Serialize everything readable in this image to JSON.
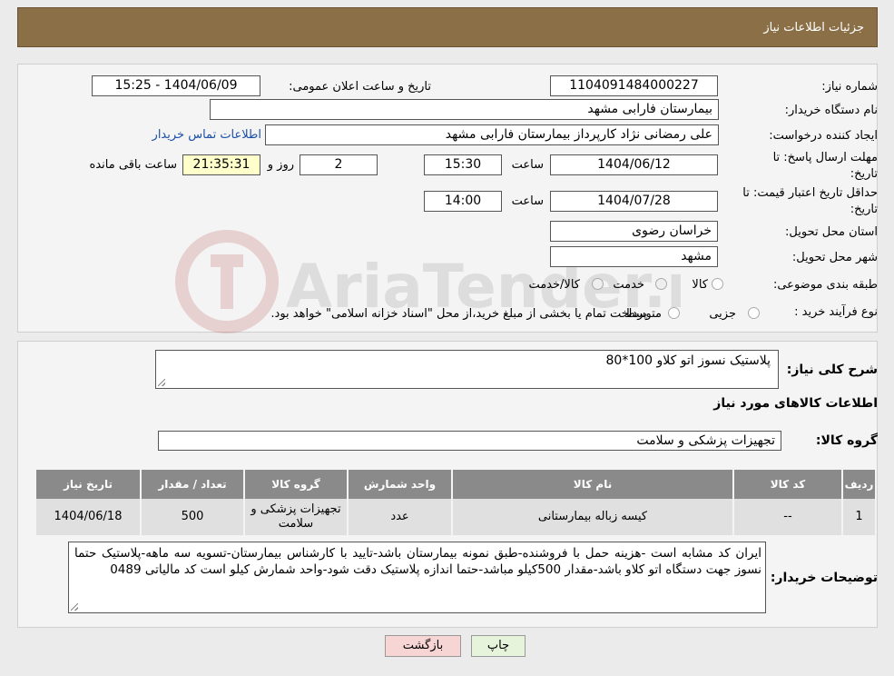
{
  "header": {
    "title": "جزئیات اطلاعات نیاز"
  },
  "watermark": {
    "text": "AriaTender.neT"
  },
  "form": {
    "need_number_label": "شماره نیاز:",
    "need_number": "1104091484000227",
    "announce_label": "تاریخ و ساعت اعلان عمومی:",
    "announce_value": "1404/06/09 - 15:25",
    "buyer_org_label": "نام دستگاه خریدار:",
    "buyer_org": "بیمارستان فارابی مشهد",
    "creator_label": "ایجاد کننده درخواست:",
    "creator": "علی رمضانی نژاد کارپرداز بیمارستان فارابی مشهد",
    "contact_link": "اطلاعات تماس خریدار",
    "deadline_label_1": "مهلت ارسال پاسخ: تا",
    "deadline_label_2": "تاریخ:",
    "deadline_date": "1404/06/12",
    "time_word": "ساعت",
    "deadline_time": "15:30",
    "days_value": "2",
    "days_word": "روز و",
    "remaining_time": "21:35:31",
    "remaining_label": "ساعت باقی مانده",
    "validity_label_1": "حداقل تاریخ اعتبار قیمت: تا",
    "validity_label_2": "تاریخ:",
    "validity_date": "1404/07/28",
    "validity_time": "14:00",
    "province_label": "استان محل تحویل:",
    "province": "خراسان رضوی",
    "city_label": "شهر محل تحویل:",
    "city": "مشهد",
    "category_label": "طبقه بندی موضوعی:",
    "category_options": [
      "کالا",
      "خدمت",
      "کالا/خدمت"
    ],
    "process_label": "نوع فرآیند خرید :",
    "process_options": [
      "جزیی",
      "متوسط"
    ],
    "process_note": "پرداخت تمام یا بخشی از مبلغ خرید،از محل \"اسناد خزانه اسلامی\" خواهد بود."
  },
  "details": {
    "summary_label": "شرح کلی نیاز:",
    "summary": "پلاستیک نسوز اتو کلاو 100*80",
    "goods_info_title": "اطلاعات کالاهای مورد نیاز",
    "group_label": "گروه کالا:",
    "group_value": "تجهیزات پزشکی و سلامت",
    "table": {
      "headers": [
        "ردیف",
        "کد کالا",
        "نام کالا",
        "واحد شمارش",
        "گروه کالا",
        "تعداد / مقدار",
        "تاریخ نیاز"
      ],
      "rows": [
        [
          "1",
          "--",
          "کیسه زباله بیمارستانی",
          "عدد",
          "تجهیزات پزشکی و سلامت",
          "500",
          "1404/06/18"
        ]
      ]
    },
    "buyer_notes_label": "توضیحات خریدار:",
    "buyer_notes": "ایران کد مشابه است -هزینه حمل با فروشنده-طبق نمونه بیمارستان باشد-تایید با کارشناس بیمارستان-تسویه سه ماهه-پلاستیک حتما نسوز جهت دستگاه اتو کلاو باشد-مقدار 500کیلو مباشد-حتما اندازه پلاستیک دقت شود-واحد شمارش کیلو است کد مالیاتی 0489"
  },
  "buttons": {
    "print": "چاپ",
    "back": "بازگشت"
  },
  "colors": {
    "header_bg": "#8b6f47",
    "link": "#1b4fa8",
    "yellow_field": "#ffffcc",
    "back_button": "#f7d5d5",
    "print_button": "#e6f4dc"
  }
}
